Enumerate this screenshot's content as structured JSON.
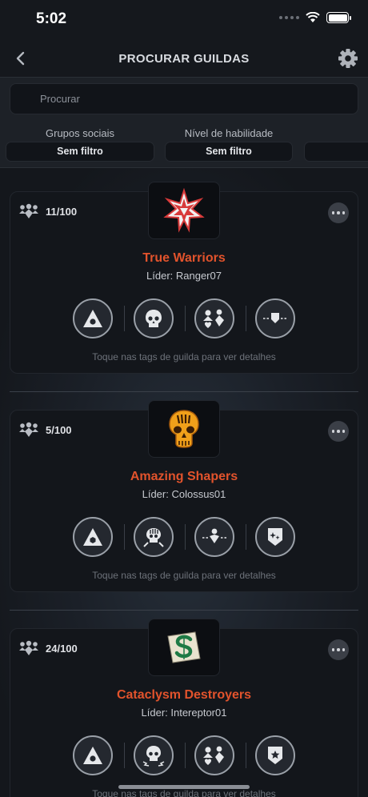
{
  "status_bar": {
    "time": "5:02"
  },
  "header": {
    "title": "PROCURAR GUILDAS"
  },
  "search": {
    "placeholder": "Procurar"
  },
  "filters": [
    {
      "label": "Grupos sociais",
      "value": "Sem filtro"
    },
    {
      "label": "Nível de habilidade",
      "value": "Sem filtro"
    }
  ],
  "guilds": [
    {
      "members": "11/100",
      "name": "True Warriors",
      "leader": "Líder: Ranger07",
      "hint": "Toque nas tags de guilda para ver detalhes"
    },
    {
      "members": "5/100",
      "name": "Amazing Shapers",
      "leader": "Líder: Colossus01",
      "hint": "Toque nas tags de guilda para ver detalhes"
    },
    {
      "members": "24/100",
      "name": "Cataclysm Destroyers",
      "leader": "Líder: Intereptor01",
      "hint": "Toque nas tags de guilda para ver detalhes"
    }
  ],
  "icons": {
    "back": "chevron-left-icon",
    "settings": "gear-icon",
    "members": "group-icon",
    "more": "ellipsis-icon"
  },
  "colors": {
    "guild_name": "#e2532c",
    "background": "#15181d"
  }
}
